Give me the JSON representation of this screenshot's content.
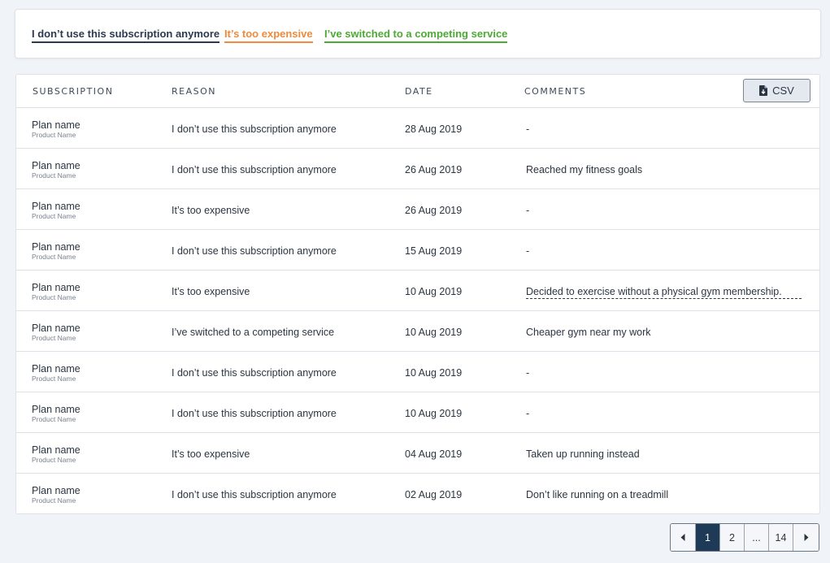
{
  "legend": [
    {
      "label": "I don’t use this subscription anymore",
      "color": "#2b3a4e"
    },
    {
      "label": "It’s too expensive",
      "color": "#f08a3c"
    },
    {
      "label": "I’ve switched to a competing service",
      "color": "#4caa34"
    }
  ],
  "table": {
    "headers": {
      "subscription": "SUBSCRIPTION",
      "reason": "REASON",
      "date": "DATE",
      "comments": "COMMENTS"
    },
    "csv_label": "CSV",
    "rows": [
      {
        "plan": "Plan name",
        "product": "Product Name",
        "reason": "I don’t use this subscription anymore",
        "date": "28 Aug 2019",
        "comment": "-"
      },
      {
        "plan": "Plan name",
        "product": "Product Name",
        "reason": "I don’t use this subscription anymore",
        "date": "26 Aug 2019",
        "comment": "Reached my fitness goals"
      },
      {
        "plan": "Plan name",
        "product": "Product Name",
        "reason": "It’s too expensive",
        "date": "26 Aug 2019",
        "comment": "-"
      },
      {
        "plan": "Plan name",
        "product": "Product Name",
        "reason": "I don’t use this subscription anymore",
        "date": "15 Aug 2019",
        "comment": "-"
      },
      {
        "plan": "Plan name",
        "product": "Product Name",
        "reason": "It’s too expensive",
        "date": "10 Aug 2019",
        "comment": "Decided to exercise without a physical gym membership.",
        "truncated": true
      },
      {
        "plan": "Plan name",
        "product": "Product Name",
        "reason": "I’ve switched to a competing service",
        "date": "10 Aug 2019",
        "comment": "Cheaper gym near my work"
      },
      {
        "plan": "Plan name",
        "product": "Product Name",
        "reason": "I don’t use this subscription anymore",
        "date": "10 Aug 2019",
        "comment": "-"
      },
      {
        "plan": "Plan name",
        "product": "Product Name",
        "reason": "I don’t use this subscription anymore",
        "date": "10 Aug 2019",
        "comment": "-"
      },
      {
        "plan": "Plan name",
        "product": "Product Name",
        "reason": "It’s too expensive",
        "date": "04 Aug 2019",
        "comment": "Taken up running instead"
      },
      {
        "plan": "Plan name",
        "product": "Product Name",
        "reason": "I don’t use this subscription anymore",
        "date": "02 Aug 2019",
        "comment": "Don’t like running on a treadmill"
      }
    ]
  },
  "pagination": {
    "pages": [
      "1",
      "2",
      "...",
      "14"
    ],
    "current": "1",
    "prev_icon": "caret-left-icon",
    "next_icon": "caret-right-icon"
  }
}
